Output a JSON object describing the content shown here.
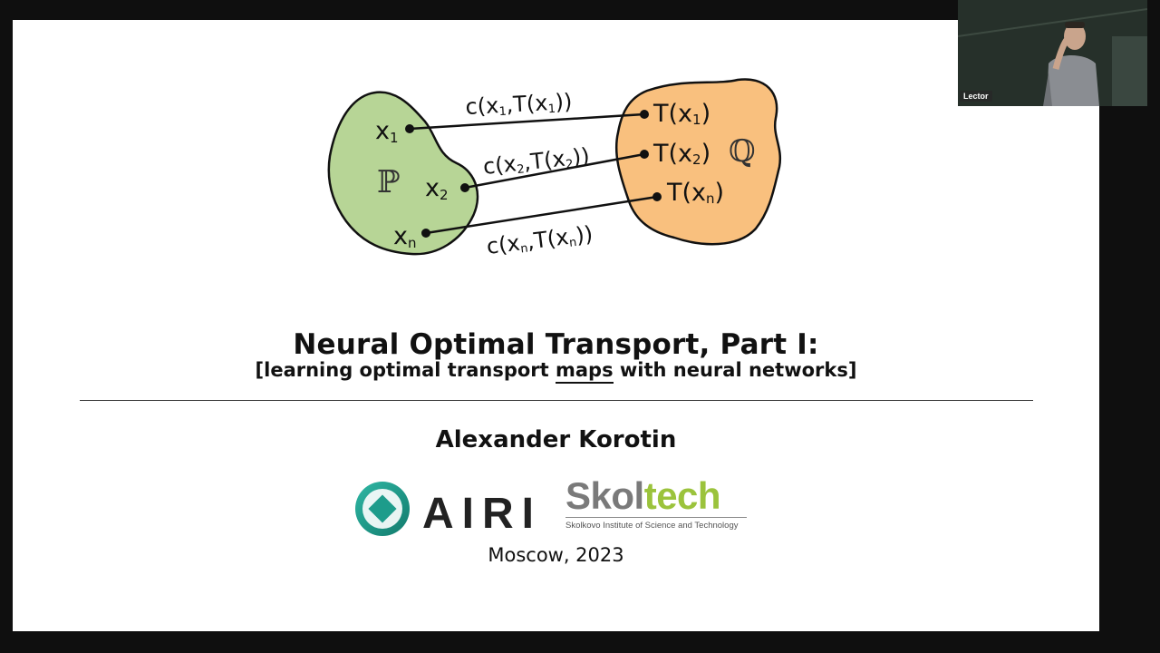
{
  "diagram": {
    "left_set_symbol": "ℙ",
    "right_set_symbol": "ℚ",
    "points_left": [
      {
        "base": "x",
        "sub": "1"
      },
      {
        "base": "x",
        "sub": "2"
      },
      {
        "base": "x",
        "sub": "n"
      }
    ],
    "points_right": [
      {
        "pre": "T(x",
        "sub": "1",
        "post": ")"
      },
      {
        "pre": "T(x",
        "sub": "2",
        "post": ")"
      },
      {
        "pre": "T(x",
        "sub": "n",
        "post": ")"
      }
    ],
    "costs": [
      {
        "a": "c(x",
        "s1": "1",
        "b": ",T(x",
        "s2": "1",
        "c": "))"
      },
      {
        "a": "c(x",
        "s1": "2",
        "b": ",T(x",
        "s2": "2",
        "c": "))"
      },
      {
        "a": "c(x",
        "s1": "n",
        "b": ",T(x",
        "s2": "n",
        "c": "))"
      }
    ],
    "colors": {
      "left_fill": "#b7d596",
      "right_fill": "#f9c07e",
      "ink": "#111111"
    }
  },
  "slide": {
    "title": "Neural Optimal Transport, Part I:",
    "subtitle_pre": "[learning optimal transport ",
    "subtitle_underlined": "maps",
    "subtitle_post": " with neural networks]",
    "author": "Alexander Korotin",
    "logo_airi_text": "AIRI",
    "logo_skoltech_part1": "Skol",
    "logo_skoltech_part2": "tech",
    "logo_skoltech_subtitle": "Skolkovo Institute of Science and Technology",
    "place": "Moscow,  2023"
  },
  "webcam": {
    "label": "Lector"
  }
}
